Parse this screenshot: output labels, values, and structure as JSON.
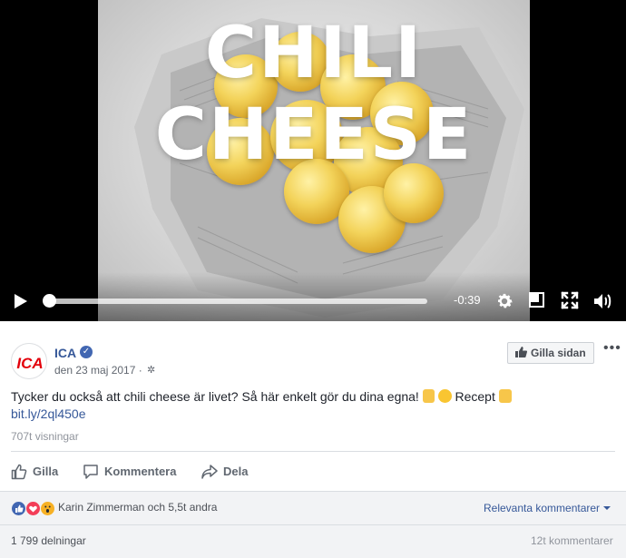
{
  "video": {
    "overlay_line1": "CHILI",
    "overlay_line2": "CHEESE",
    "time_remaining": "-0:39",
    "progress_fraction": 0.0,
    "icons": [
      "play-icon",
      "gear-icon",
      "picture-in-picture-icon",
      "fullscreen-icon",
      "volume-icon"
    ]
  },
  "post": {
    "page_name": "ICA",
    "logo_text": "ICA",
    "date": "den 23 maj 2017 ·",
    "like_page_label": "Gilla sidan",
    "text": "Tycker du också att chili cheese är livet? Så här enkelt gör du dina egna!",
    "recipe_label": "Recept",
    "link": "bit.ly/2ql450e",
    "views": "707t visningar",
    "actions": {
      "like": "Gilla",
      "comment": "Kommentera",
      "share": "Dela"
    },
    "reactions_names": "Karin Zimmerman och 5,5t andra",
    "relevant_comments": "Relevanta kommentarer",
    "shares": "1 799 delningar",
    "comments_count": "12t kommentarer"
  },
  "colors": {
    "link_blue": "#365899",
    "brand_red": "#e3000b",
    "like_blue": "#4267b2",
    "love_red": "#f33e58",
    "wow_yellow": "#f7b125"
  }
}
